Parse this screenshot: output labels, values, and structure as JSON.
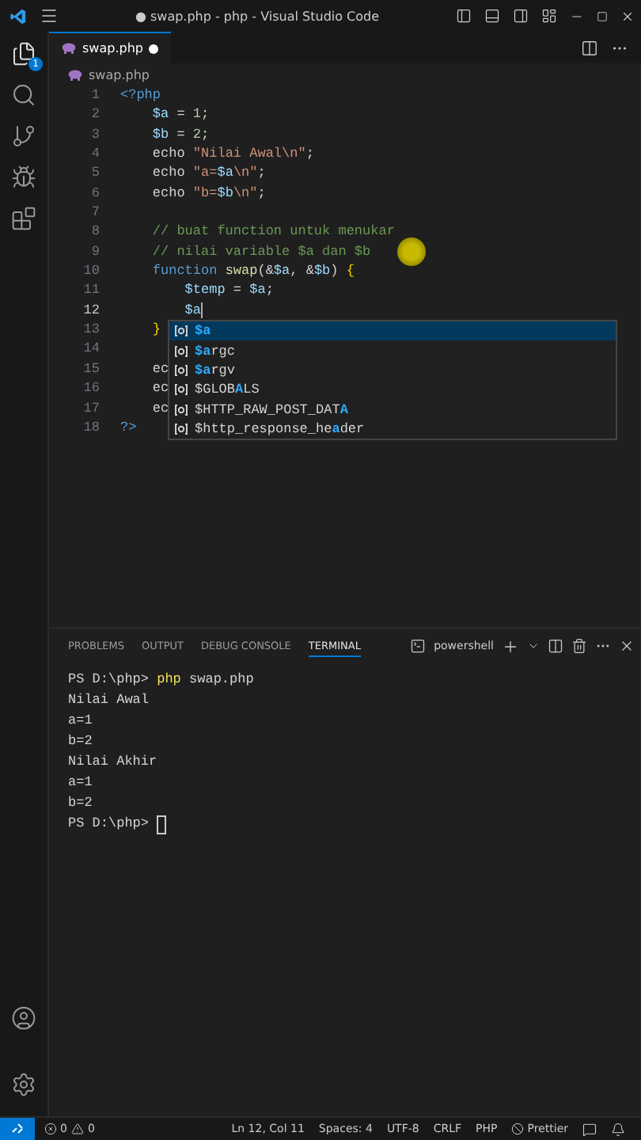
{
  "window": {
    "title": "● swap.php - php - Visual Studio Code"
  },
  "activity_bar": {
    "explorer_badge": "1"
  },
  "tab": {
    "label": "swap.php",
    "dirty": true
  },
  "breadcrumb": "swap.php",
  "code_lines": [
    {
      "number": "1",
      "active": false,
      "tokens": [
        {
          "kind": "tag",
          "text": "<?php"
        }
      ]
    },
    {
      "number": "2",
      "active": false,
      "tokens": [
        {
          "kind": "var",
          "text": "    $a"
        },
        {
          "kind": "plain",
          "text": " = "
        },
        {
          "kind": "num",
          "text": "1"
        },
        {
          "kind": "plain",
          "text": ";"
        }
      ]
    },
    {
      "number": "3",
      "active": false,
      "tokens": [
        {
          "kind": "var",
          "text": "    $b"
        },
        {
          "kind": "plain",
          "text": " = "
        },
        {
          "kind": "num",
          "text": "2"
        },
        {
          "kind": "plain",
          "text": ";"
        }
      ]
    },
    {
      "number": "4",
      "active": false,
      "tokens": [
        {
          "kind": "plain",
          "text": "    echo "
        },
        {
          "kind": "str",
          "text": "\"Nilai Awal\\n\""
        },
        {
          "kind": "plain",
          "text": ";"
        }
      ]
    },
    {
      "number": "5",
      "active": false,
      "tokens": [
        {
          "kind": "plain",
          "text": "    echo "
        },
        {
          "kind": "str",
          "text": "\"a="
        },
        {
          "kind": "var",
          "text": "$a"
        },
        {
          "kind": "str",
          "text": "\\n\""
        },
        {
          "kind": "plain",
          "text": ";"
        }
      ]
    },
    {
      "number": "6",
      "active": false,
      "tokens": [
        {
          "kind": "plain",
          "text": "    echo "
        },
        {
          "kind": "str",
          "text": "\"b="
        },
        {
          "kind": "var",
          "text": "$b"
        },
        {
          "kind": "str",
          "text": "\\n\""
        },
        {
          "kind": "plain",
          "text": ";"
        }
      ]
    },
    {
      "number": "7",
      "active": false
    },
    {
      "number": "8",
      "active": false,
      "tokens": [
        {
          "kind": "comment",
          "text": "    // buat function untuk menukar"
        }
      ]
    },
    {
      "number": "9",
      "active": false,
      "tokens": [
        {
          "kind": "comment",
          "text": "    // nilai variable $a dan $b"
        }
      ]
    },
    {
      "number": "10",
      "active": false,
      "tokens": [
        {
          "kind": "kw",
          "text": "    function "
        },
        {
          "kind": "fn",
          "text": "swap"
        },
        {
          "kind": "plain",
          "text": "(&"
        },
        {
          "kind": "var",
          "text": "$a"
        },
        {
          "kind": "plain",
          "text": ", &"
        },
        {
          "kind": "var",
          "text": "$b"
        },
        {
          "kind": "plain",
          "text": ") "
        },
        {
          "kind": "brace",
          "text": "{"
        }
      ]
    },
    {
      "number": "11",
      "active": false,
      "tokens": [
        {
          "kind": "var",
          "text": "        $temp"
        },
        {
          "kind": "plain",
          "text": " = "
        },
        {
          "kind": "var",
          "text": "$a"
        },
        {
          "kind": "plain",
          "text": ";"
        }
      ]
    },
    {
      "number": "12",
      "active": true,
      "tokens": [
        {
          "kind": "var",
          "text": "        $a"
        }
      ]
    },
    {
      "number": "13",
      "active": false,
      "tokens": [
        {
          "kind": "brace",
          "text": "    }"
        }
      ]
    },
    {
      "number": "14",
      "active": false
    },
    {
      "number": "15",
      "active": false,
      "tokens": [
        {
          "kind": "plain",
          "text": "    ec"
        }
      ]
    },
    {
      "number": "16",
      "active": false,
      "tokens": [
        {
          "kind": "plain",
          "text": "    ec"
        }
      ]
    },
    {
      "number": "17",
      "active": false,
      "tokens": [
        {
          "kind": "plain",
          "text": "    ec"
        }
      ]
    },
    {
      "number": "18",
      "active": false,
      "tokens": [
        {
          "kind": "tag",
          "text": "?>"
        }
      ]
    }
  ],
  "suggestions": [
    {
      "selected": true,
      "parts": [
        {
          "text": "$a",
          "match": true
        }
      ]
    },
    {
      "selected": false,
      "parts": [
        {
          "text": "$a",
          "match": true
        },
        {
          "text": "rgc",
          "match": false
        }
      ]
    },
    {
      "selected": false,
      "parts": [
        {
          "text": "$a",
          "match": true
        },
        {
          "text": "rgv",
          "match": false
        }
      ]
    },
    {
      "selected": false,
      "parts": [
        {
          "text": "$GLOB",
          "match": false
        },
        {
          "text": "A",
          "match": true
        },
        {
          "text": "LS",
          "match": false
        }
      ]
    },
    {
      "selected": false,
      "parts": [
        {
          "text": "$HTTP_RAW_POST_DAT",
          "match": false
        },
        {
          "text": "A",
          "match": true
        }
      ]
    },
    {
      "selected": false,
      "parts": [
        {
          "text": "$http_response_he",
          "match": false
        },
        {
          "text": "a",
          "match": true
        },
        {
          "text": "der",
          "match": false
        }
      ]
    }
  ],
  "panel_tabs": [
    {
      "label": "PROBLEMS",
      "selected": false
    },
    {
      "label": "OUTPUT",
      "selected": false
    },
    {
      "label": "DEBUG CONSOLE",
      "selected": false
    },
    {
      "label": "TERMINAL",
      "selected": true
    }
  ],
  "terminal_name": "powershell",
  "terminal_lines": [
    {
      "parts": [
        {
          "kind": "plain",
          "text": "PS D:\\php> "
        },
        {
          "kind": "command",
          "text": "php"
        },
        {
          "kind": "plain",
          "text": " swap.php"
        }
      ],
      "cursor": false
    },
    {
      "parts": [
        {
          "kind": "plain",
          "text": "Nilai Awal"
        }
      ],
      "cursor": false
    },
    {
      "parts": [
        {
          "kind": "plain",
          "text": "a=1"
        }
      ],
      "cursor": false
    },
    {
      "parts": [
        {
          "kind": "plain",
          "text": "b=2"
        }
      ],
      "cursor": false
    },
    {
      "parts": [
        {
          "kind": "plain",
          "text": "Nilai Akhir"
        }
      ],
      "cursor": false
    },
    {
      "parts": [
        {
          "kind": "plain",
          "text": "a=1"
        }
      ],
      "cursor": false
    },
    {
      "parts": [
        {
          "kind": "plain",
          "text": "b=2"
        }
      ],
      "cursor": false
    },
    {
      "parts": [
        {
          "kind": "plain",
          "text": "PS D:\\php> "
        }
      ],
      "cursor": true
    }
  ],
  "status_bar": {
    "errors": "0",
    "warnings": "0",
    "items": [
      "Ln 12, Col 11",
      "Spaces: 4",
      "UTF-8",
      "CRLF",
      "PHP"
    ],
    "prettier": "Prettier"
  }
}
